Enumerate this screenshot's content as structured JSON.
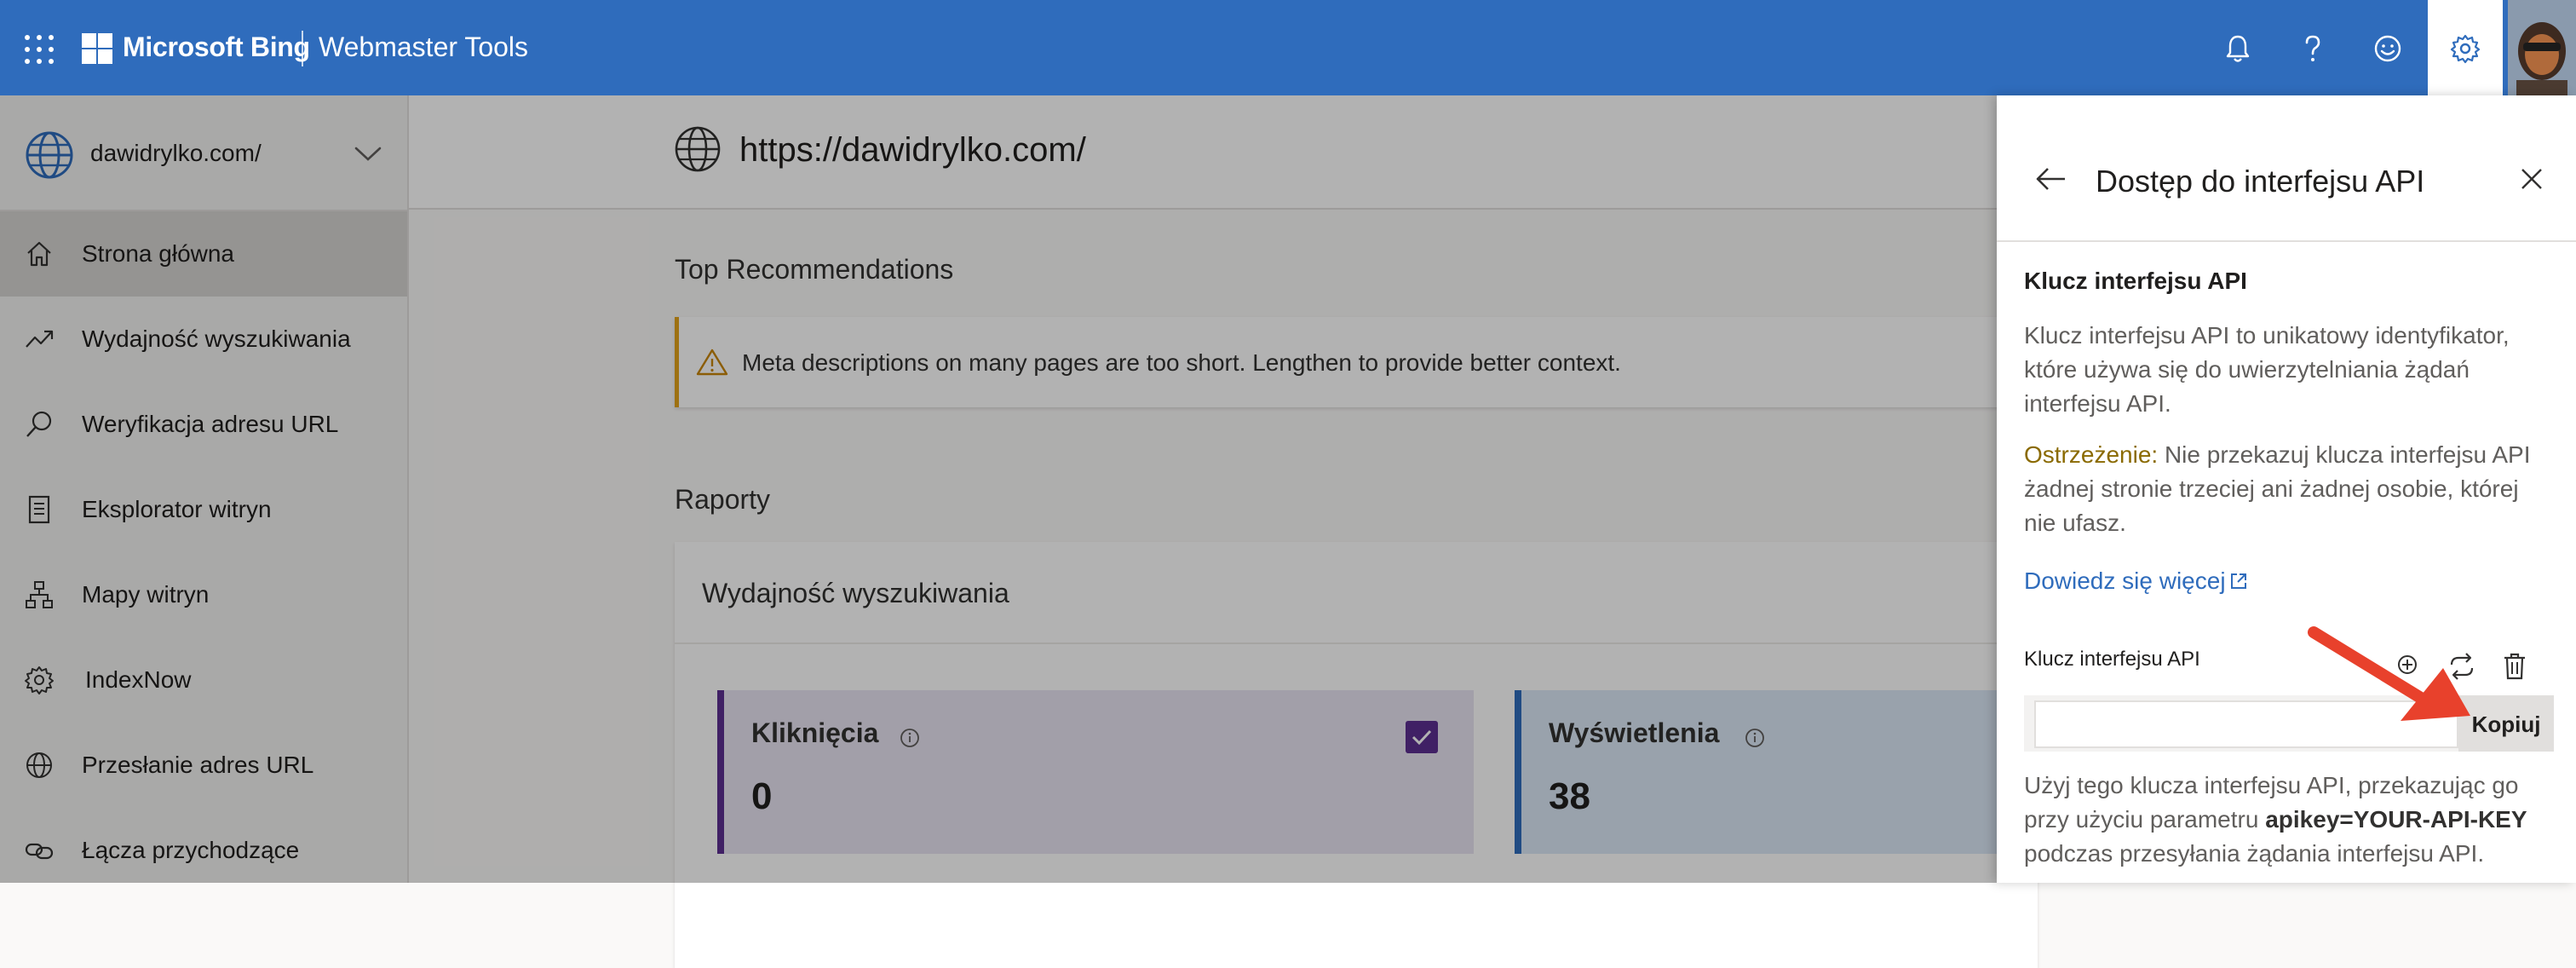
{
  "header": {
    "brand": "Microsoft Bing",
    "product": "Webmaster Tools",
    "colors": {
      "bar": "#2f6cbc"
    },
    "icons": [
      "app-launcher-icon",
      "microsoft-logo-icon",
      "bell-icon",
      "help-icon",
      "smiley-icon",
      "gear-icon",
      "avatar"
    ]
  },
  "sidebar": {
    "site": "dawidrylko.com/",
    "items": [
      {
        "label": "Strona główna",
        "icon": "home-icon",
        "active": true
      },
      {
        "label": "Wydajność wyszukiwania",
        "icon": "trend-icon"
      },
      {
        "label": "Weryfikacja adresu URL",
        "icon": "search-icon"
      },
      {
        "label": "Eksplorator witryn",
        "icon": "document-icon"
      },
      {
        "label": "Mapy witryn",
        "icon": "sitemap-icon"
      },
      {
        "label": "IndexNow",
        "icon": "gear-icon"
      },
      {
        "label": "Przesłanie adres URL",
        "icon": "globe-icon"
      },
      {
        "label": "Łącza przychodzące",
        "icon": "link-icon"
      }
    ]
  },
  "main": {
    "url": "https://dawidrylko.com/",
    "top_recommendations": "Top Recommendations",
    "alert_text": "Meta descriptions on many pages are too short. Lengthen to provide better context.",
    "reports": "Raporty",
    "card_title": "Wydajność wyszukiwania",
    "metrics": [
      {
        "label": "Kliknięcia",
        "value": "0"
      },
      {
        "label": "Wyświetlenia",
        "value": "38"
      }
    ]
  },
  "panel": {
    "title": "Dostęp do interfejsu API",
    "heading": "Klucz interfejsu API",
    "description": "Klucz interfejsu API to unikatowy identyfikator, które używa się do uwierzytelniania żądań interfejsu API.",
    "warning_label": "Ostrzeżenie:",
    "warning_text": " Nie przekazuj klucza interfejsu API żadnej stronie trzeciej ani żadnej osobie, której nie ufasz.",
    "learn_more": "Dowiedz się więcej",
    "key_label": "Klucz interfejsu API",
    "key_value": "",
    "copy_button": "Kopiuj",
    "usage_before": "Użyj tego klucza interfejsu API, przekazując go przy użyciu parametru ",
    "usage_param": "apikey=YOUR-API-KEY",
    "usage_after": " podczas przesyłania żądania interfejsu API."
  }
}
